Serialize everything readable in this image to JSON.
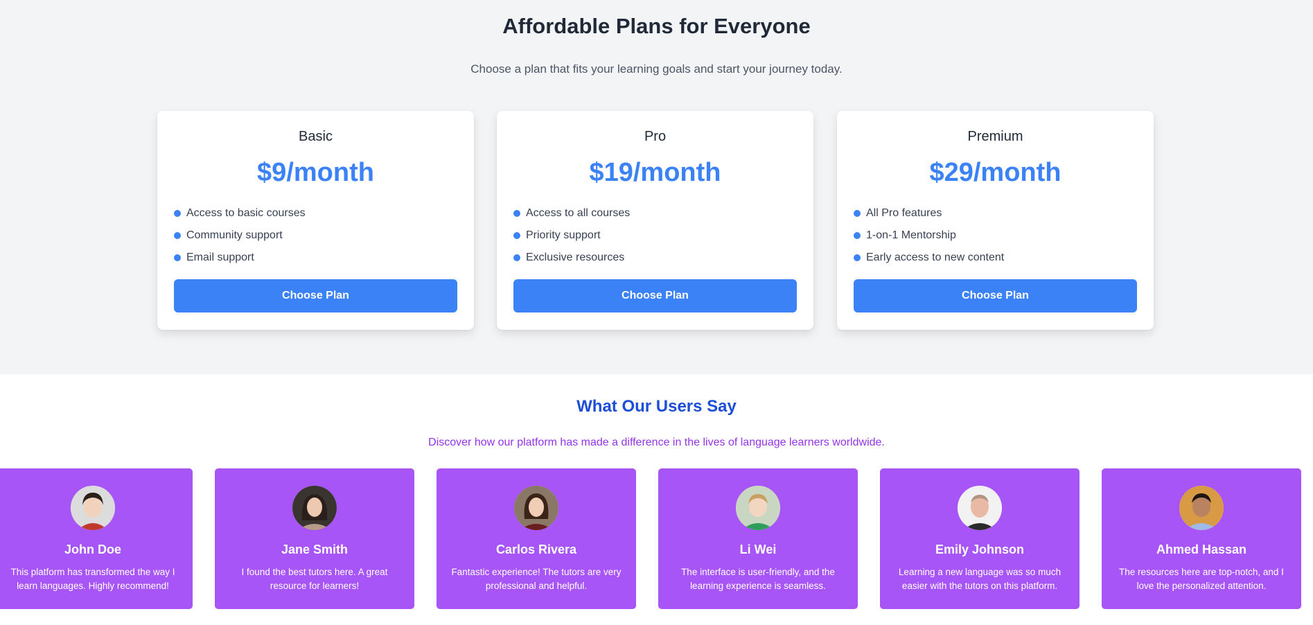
{
  "pricing": {
    "title": "Affordable Plans for Everyone",
    "subtitle": "Choose a plan that fits your learning goals and start your journey today.",
    "plans": [
      {
        "name": "Basic",
        "price": "$9/month",
        "features": [
          "Access to basic courses",
          "Community support",
          "Email support"
        ],
        "button_label": "Choose Plan"
      },
      {
        "name": "Pro",
        "price": "$19/month",
        "features": [
          "Access to all courses",
          "Priority support",
          "Exclusive resources"
        ],
        "button_label": "Choose Plan"
      },
      {
        "name": "Premium",
        "price": "$29/month",
        "features": [
          "All Pro features",
          "1-on-1 Mentorship",
          "Early access to new content"
        ],
        "button_label": "Choose Plan"
      }
    ]
  },
  "testimonials": {
    "title": "What Our Users Say",
    "subtitle": "Discover how our platform has made a difference in the lives of language learners worldwide.",
    "items": [
      {
        "name": "John Doe",
        "quote": "This platform has transformed the way I learn languages. Highly recommend!"
      },
      {
        "name": "Jane Smith",
        "quote": "I found the best tutors here. A great resource for learners!"
      },
      {
        "name": "Carlos Rivera",
        "quote": "Fantastic experience! The tutors are very professional and helpful."
      },
      {
        "name": "Li Wei",
        "quote": "The interface is user-friendly, and the learning experience is seamless."
      },
      {
        "name": "Emily Johnson",
        "quote": "Learning a new language was so much easier with the tutors on this platform."
      },
      {
        "name": "Ahmed Hassan",
        "quote": "The resources here are top-notch, and I love the personalized attention."
      }
    ]
  },
  "colors": {
    "accent": "#3b82f6",
    "testimonial_card": "#a855f7",
    "testimonial_title": "#1d4ed8",
    "testimonial_subtitle": "#9333ea",
    "pricing_background": "#f3f4f6"
  },
  "icons": {
    "feature_bullet": "bullet-dot-icon",
    "avatar": "user-avatar-photo"
  }
}
